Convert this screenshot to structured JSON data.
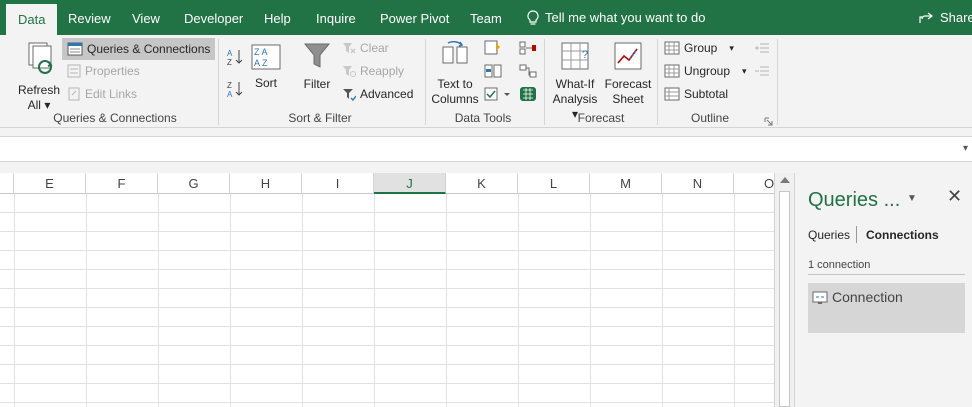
{
  "tabs": [
    {
      "label": "Data",
      "active": true
    },
    {
      "label": "Review"
    },
    {
      "label": "View"
    },
    {
      "label": "Developer"
    },
    {
      "label": "Help"
    },
    {
      "label": "Inquire"
    },
    {
      "label": "Power Pivot"
    },
    {
      "label": "Team"
    }
  ],
  "tell_me": "Tell me what you want to do",
  "share": "Share",
  "ribbon": {
    "queries": {
      "refresh_all_line1": "Refresh",
      "refresh_all_line2": "All",
      "queries_connections": "Queries & Connections",
      "properties": "Properties",
      "edit_links": "Edit Links",
      "group_label": "Queries & Connections"
    },
    "sort_filter": {
      "sort": "Sort",
      "filter": "Filter",
      "clear": "Clear",
      "reapply": "Reapply",
      "advanced": "Advanced",
      "group_label": "Sort & Filter"
    },
    "data_tools": {
      "text_to_columns_line1": "Text to",
      "text_to_columns_line2": "Columns",
      "group_label": "Data Tools"
    },
    "forecast": {
      "what_if_line1": "What-If",
      "what_if_line2": "Analysis",
      "forecast_sheet_line1": "Forecast",
      "forecast_sheet_line2": "Sheet",
      "group_label": "Forecast"
    },
    "outline": {
      "group": "Group",
      "ungroup": "Ungroup",
      "subtotal": "Subtotal",
      "group_label": "Outline"
    }
  },
  "columns": [
    "E",
    "F",
    "G",
    "H",
    "I",
    "J",
    "K",
    "L",
    "M",
    "N",
    "O"
  ],
  "active_column": "J",
  "pane": {
    "title": "Queries ...",
    "tab_queries": "Queries",
    "tab_connections": "Connections",
    "count": "1 connection",
    "item": "Connection"
  },
  "colors": {
    "accent": "#217346",
    "ribbon_bg": "#f3f3f3",
    "selected": "#c6c6c6"
  }
}
